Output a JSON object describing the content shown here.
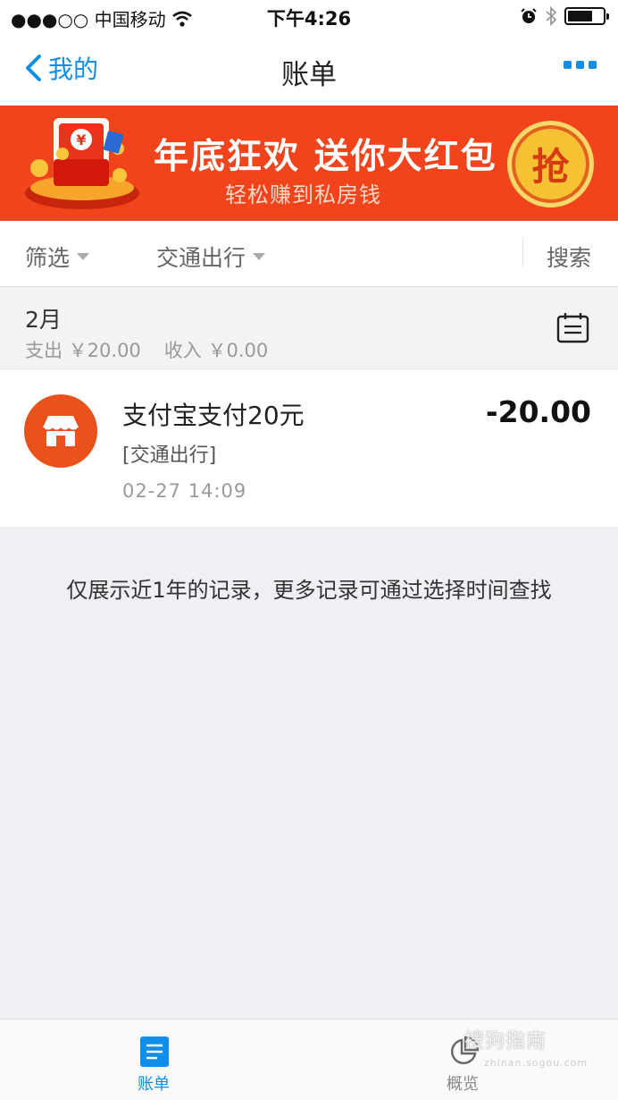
{
  "status_bar": {
    "carrier": "●●●○○ 中国移动",
    "time": "下午4:26",
    "battery_level": 0.72
  },
  "nav": {
    "back_label": "我的",
    "title": "账单",
    "icons": {
      "back": "chevron-left-icon",
      "more": "more-dots-icon"
    }
  },
  "banner": {
    "title": "年底狂欢 送你大红包",
    "subtitle": "轻松赚到私房钱",
    "button_label": "抢",
    "art_symbol": "¥"
  },
  "filters": {
    "filter_label": "筛选",
    "category_label": "交通出行",
    "search_label": "搜索"
  },
  "month": {
    "label": "2月",
    "expense": "支出 ￥20.00",
    "income": "收入 ￥0.00"
  },
  "records": [
    {
      "title": "支付宝支付20元",
      "category": "[交通出行]",
      "time": "02-27  14:09",
      "amount": "-20.00",
      "icon": "store-icon"
    }
  ],
  "notice": "仅展示近1年的记录，更多记录可通过选择时间查找",
  "tabs": [
    {
      "label": "账单",
      "icon": "bill-icon",
      "active": true
    },
    {
      "label": "概览",
      "icon": "pie-chart-icon",
      "active": false
    }
  ],
  "watermark": {
    "text": "搜狗指南",
    "url": "zhinan.sogou.com"
  },
  "colors": {
    "accent": "#108ee9",
    "banner": "#f1441d",
    "record_icon": "#e9521b",
    "tab_active": "#108ee9",
    "tab_inactive": "#888888"
  }
}
